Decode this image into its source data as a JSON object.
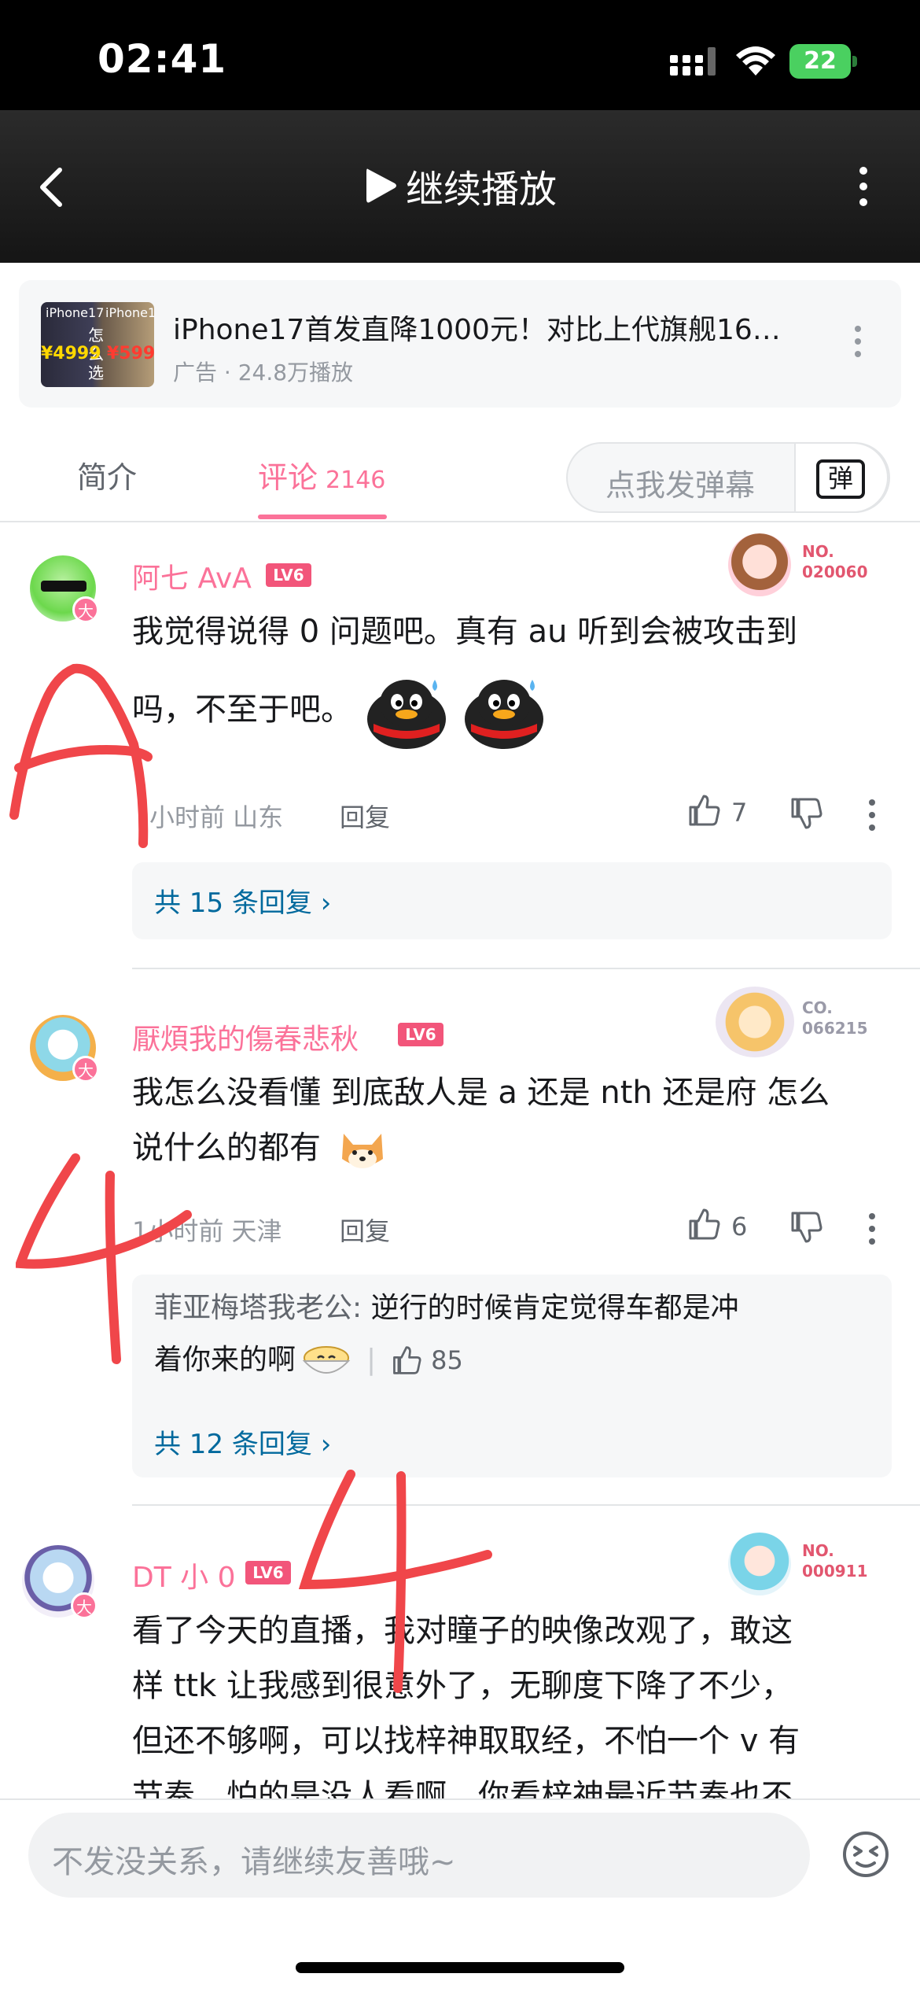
{
  "status_bar": {
    "time": "02:41",
    "battery": "22"
  },
  "video_bar": {
    "play_label": "继续播放"
  },
  "ad": {
    "title": "iPhone17首发直降1000元！对比上代旗舰16…",
    "meta": "广告 · 24.8万播放",
    "thumb_text_1": "iPhone17",
    "thumb_text_2": "iPhone16P",
    "thumb_text_3": "怎么选",
    "thumb_price_1": "¥4999",
    "thumb_price_2": "¥5999"
  },
  "tabs": {
    "intro": "简介",
    "comments": "评论",
    "comments_count": "2146",
    "danmu_placeholder": "点我发弹幕",
    "danmu_button": "弹"
  },
  "comments": [
    {
      "username": "阿七 AvA",
      "level": "LV6",
      "fan_label": "NO.",
      "fan_number": "020060",
      "text_line1": "我觉得说得 0 问题吧。真有 au 听到会被攻击到",
      "text_line2": "吗，不至于吧。",
      "meta": "小时前 山东",
      "reply_label": "回复",
      "likes": "7",
      "more_replies": "共 15 条回复"
    },
    {
      "username": "厭煩我的傷春悲秋",
      "level": "LV6",
      "fan_label": "CO.",
      "fan_number": "066215",
      "text_line1": "我怎么没看懂 到底敌人是 a 还是 nth 还是府 怎么",
      "text_line2": "说什么的都有",
      "meta": "1小时前 天津",
      "reply_label": "回复",
      "likes": "6",
      "sub_reply_name": "菲亚梅塔我老公:",
      "sub_reply_text_1": " 逆行的时候肯定觉得车都是冲",
      "sub_reply_text_2": "着你来的啊",
      "sub_reply_likes": "85",
      "more_replies": "共 12 条回复"
    },
    {
      "username": "DT 小 0",
      "level": "LV6",
      "fan_label": "NO.",
      "fan_number": "000911",
      "text_line1": "看了今天的直播，我对瞳子的映像改观了，敢这",
      "text_line2": "样 ttk 让我感到很意外了，无聊度下降了不少，",
      "text_line3": "但还不够啊，可以找梓神取取经，不怕一个 v 有",
      "text_line4": "节奏，怕的是没人看啊，你看梓神最近节奏也不"
    }
  ],
  "annotations": {
    "mark_1": "A",
    "mark_2": "4",
    "mark_3": "4"
  },
  "bottom": {
    "input_placeholder": "不发没关系，请继续友善哦~"
  },
  "colors": {
    "accent": "#fb7299",
    "link": "#00699d",
    "scribble": "#f0464a"
  }
}
